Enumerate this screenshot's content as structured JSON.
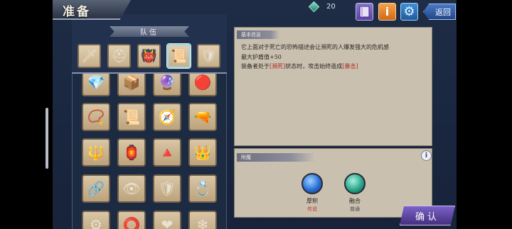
{
  "header": {
    "title": "准备",
    "currency_icon": "gem-icon",
    "currency_value": "20",
    "back_label": "返回"
  },
  "toolbar": {
    "book_icon": "book-icon",
    "info_icon": "info-icon",
    "info_glyph": "i",
    "settings_icon": "gear-icon",
    "settings_glyph": "⚙"
  },
  "team": {
    "label": "队伍",
    "slots": [
      {
        "icon": "sword-icon",
        "glyph": "🗡"
      },
      {
        "icon": "horned-helmet-icon",
        "glyph": "⛑"
      },
      {
        "icon": "demon-mask-icon",
        "glyph": "👹"
      },
      {
        "icon": "scroll-icon",
        "glyph": "📜",
        "selected": true
      },
      {
        "icon": "golden-gauntlet-icon",
        "glyph": "🛡"
      }
    ]
  },
  "inventory": [
    {
      "icon": "green-gem-icon",
      "glyph": "💎"
    },
    {
      "icon": "chest-icon",
      "glyph": "📦"
    },
    {
      "icon": "purple-orb-icon",
      "glyph": "🔮"
    },
    {
      "icon": "red-amulet-icon",
      "glyph": "🔴"
    },
    {
      "icon": "bead-necklace-icon",
      "glyph": "📿"
    },
    {
      "icon": "parchment-icon",
      "glyph": "📜"
    },
    {
      "icon": "compass-icon",
      "glyph": "🧭"
    },
    {
      "icon": "cannon-icon",
      "glyph": "🔫"
    },
    {
      "icon": "golden-crest-icon",
      "glyph": "🔱"
    },
    {
      "icon": "lantern-icon",
      "glyph": "🏮"
    },
    {
      "icon": "pyramid-icon",
      "glyph": "🔺"
    },
    {
      "icon": "red-crown-icon",
      "glyph": "👑"
    },
    {
      "icon": "pendant-icon",
      "glyph": "🔗"
    },
    {
      "icon": "eye-icon",
      "glyph": "👁"
    },
    {
      "icon": "armor-icon",
      "glyph": "🛡"
    },
    {
      "icon": "ring-icon",
      "glyph": "💍"
    },
    {
      "icon": "jeweled-ring-icon",
      "glyph": "⚙"
    },
    {
      "icon": "dark-ring-icon",
      "glyph": "⭕"
    },
    {
      "icon": "ruby-icon",
      "glyph": "❤"
    },
    {
      "icon": "crystal-icon",
      "glyph": "❄"
    }
  ],
  "basic_info": {
    "title": "基本信息",
    "line1": "它上面对于死亡的恐怖描述会让濒死的人爆发强大的危机感",
    "line2": "最大护盾值+50",
    "line3_a": "装备者处于",
    "line3_hl1": "[濒死]",
    "line3_b": "状态时，攻击始终造成",
    "line3_hl2": "[暴击]"
  },
  "enchant": {
    "title": "附魔",
    "info_glyph": "i",
    "orbs": [
      {
        "name": "厚积",
        "grade": "传说",
        "grade_color": "#c0392b"
      },
      {
        "name": "融合",
        "grade": "普通",
        "grade_color": "#4a4a4a"
      }
    ]
  },
  "confirm_label": "确认"
}
